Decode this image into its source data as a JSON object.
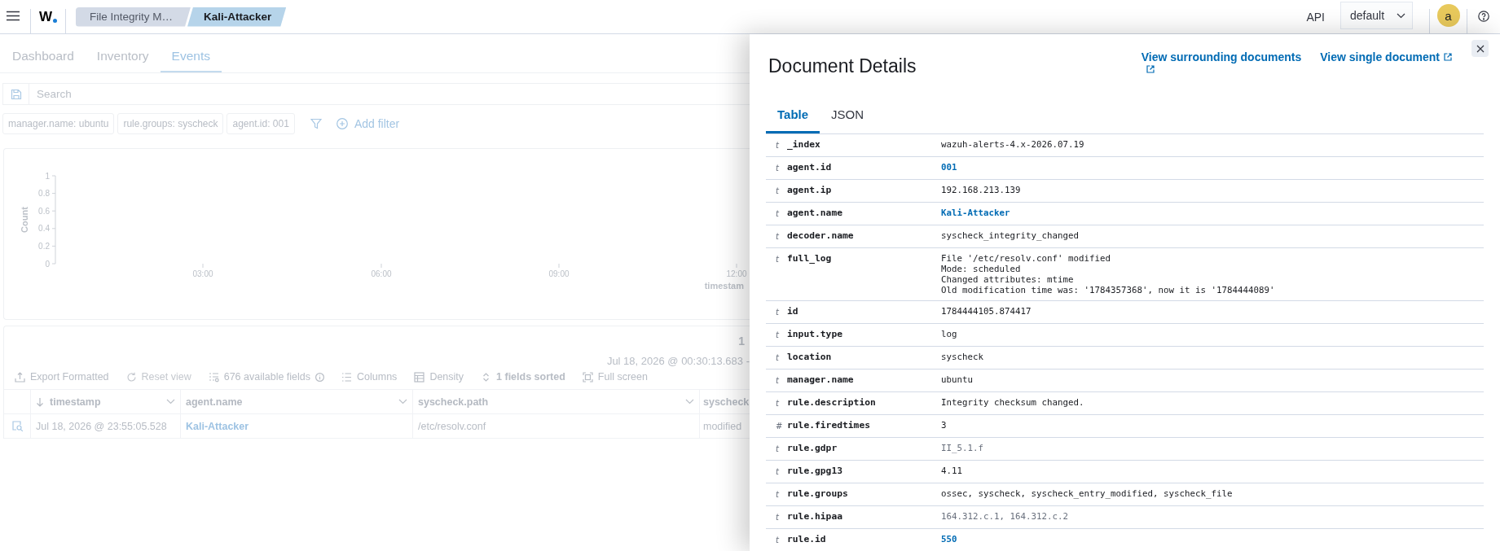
{
  "top_bar": {
    "logo": "W",
    "breadcrumbs": [
      {
        "label": "File Integrity M…",
        "selected": false
      },
      {
        "label": "Kali-Attacker",
        "selected": true
      }
    ],
    "api_label": "API",
    "api_select": "default",
    "user_initial": "a"
  },
  "tabs": [
    {
      "label": "Dashboard",
      "selected": false
    },
    {
      "label": "Inventory",
      "selected": false
    },
    {
      "label": "Events",
      "selected": true
    }
  ],
  "search": {
    "placeholder": "Search"
  },
  "filters": [
    {
      "label": "manager.name: ubuntu"
    },
    {
      "label": "rule.groups: syscheck"
    },
    {
      "label": "agent.id: 001"
    }
  ],
  "add_filter": "Add filter",
  "histogram": {
    "y_axis_title": "Count",
    "y_tick_labels": [
      "1",
      "0.8",
      "0.6",
      "0.4",
      "0.2",
      "0"
    ],
    "x_tick_labels": [
      "03:00",
      "06:00",
      "09:00",
      "12:00"
    ],
    "x_axis_title": "timestam"
  },
  "results": {
    "hits": "1",
    "time_range": "Jul 18, 2026 @ 00:30:13.683 -",
    "toolbar": [
      {
        "kind": "export",
        "label": "Export Formatted",
        "disabled": false
      },
      {
        "kind": "reset",
        "label": "Reset view",
        "disabled": true
      },
      {
        "kind": "fields",
        "label": "676 available fields",
        "disabled": false
      },
      {
        "kind": "columns",
        "label": "Columns",
        "disabled": false
      },
      {
        "kind": "density",
        "label": "Density",
        "disabled": false
      },
      {
        "kind": "sort",
        "label": "1 fields sorted",
        "disabled": false
      },
      {
        "kind": "fullscreen",
        "label": "Full screen",
        "disabled": false
      }
    ],
    "columns": [
      {
        "label": "timestamp",
        "sorted": true
      },
      {
        "label": "agent.name",
        "sorted": false
      },
      {
        "label": "syscheck.path",
        "sorted": false
      },
      {
        "label": "syscheck",
        "sorted": false
      }
    ],
    "rows": [
      {
        "cells": [
          {
            "kind": "text",
            "text": "Jul 18, 2026 @ 23:55:05.528"
          },
          {
            "kind": "link",
            "text": "Kali-Attacker"
          },
          {
            "kind": "text",
            "text": "/etc/resolv.conf"
          },
          {
            "kind": "text",
            "text": "modified"
          }
        ]
      }
    ]
  },
  "flyout": {
    "title": "Document Details",
    "links": [
      {
        "label": "View surrounding documents"
      },
      {
        "label": "View single document"
      }
    ],
    "tabs": [
      {
        "label": "Table",
        "selected": true
      },
      {
        "label": "JSON",
        "selected": false
      }
    ],
    "fields": [
      {
        "type": "t",
        "name": "_index",
        "kind": "text",
        "value": "wazuh-alerts-4.x-2026.07.19"
      },
      {
        "type": "t",
        "name": "agent.id",
        "kind": "link",
        "value": "001"
      },
      {
        "type": "t",
        "name": "agent.ip",
        "kind": "text",
        "value": "192.168.213.139"
      },
      {
        "type": "t",
        "name": "agent.name",
        "kind": "link",
        "value": "Kali-Attacker"
      },
      {
        "type": "t",
        "name": "decoder.name",
        "kind": "text",
        "value": "syscheck_integrity_changed"
      },
      {
        "type": "t",
        "name": "full_log",
        "kind": "text",
        "value": "File '/etc/resolv.conf' modified\nMode: scheduled\nChanged attributes: mtime\nOld modification time was: '1784357368', now it is '1784444089'"
      },
      {
        "type": "t",
        "name": "id",
        "kind": "text",
        "value": "1784444105.874417"
      },
      {
        "type": "t",
        "name": "input.type",
        "kind": "text",
        "value": "log"
      },
      {
        "type": "t",
        "name": "location",
        "kind": "text",
        "value": "syscheck"
      },
      {
        "type": "t",
        "name": "manager.name",
        "kind": "text",
        "value": "ubuntu"
      },
      {
        "type": "t",
        "name": "rule.description",
        "kind": "text",
        "value": "Integrity checksum changed."
      },
      {
        "type": "#",
        "name": "rule.firedtimes",
        "kind": "text",
        "value": "3"
      },
      {
        "type": "t",
        "name": "rule.gdpr",
        "kind": "muted",
        "value": "II_5.1.f"
      },
      {
        "type": "t",
        "name": "rule.gpg13",
        "kind": "text",
        "value": "4.11"
      },
      {
        "type": "t",
        "name": "rule.groups",
        "kind": "text",
        "value": "ossec, syscheck, syscheck_entry_modified, syscheck_file"
      },
      {
        "type": "t",
        "name": "rule.hipaa",
        "kind": "muted",
        "value": "164.312.c.1, 164.312.c.2"
      },
      {
        "type": "t",
        "name": "rule.id",
        "kind": "link",
        "value": "550"
      }
    ]
  }
}
